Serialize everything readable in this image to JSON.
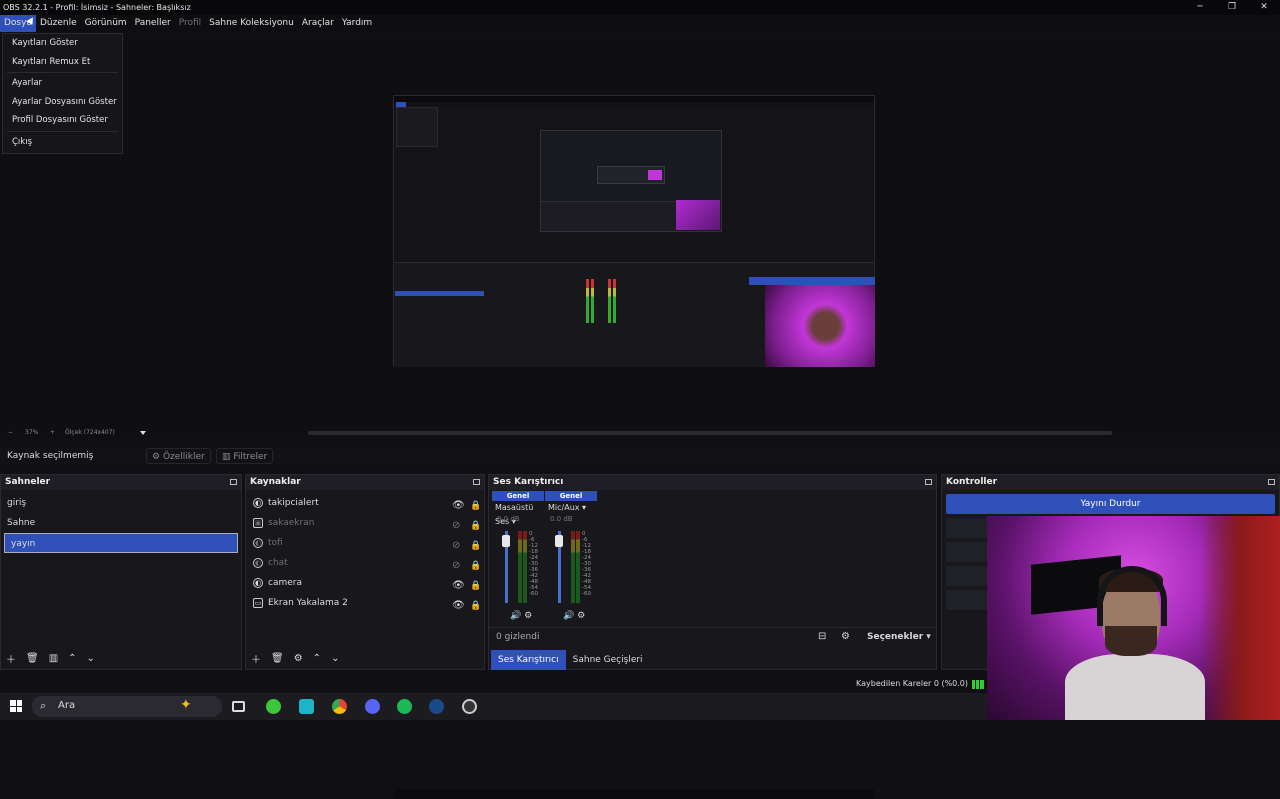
{
  "window": {
    "title": "OBS 32.2.1 - Profil: İsimsiz - Sahneler: Başlıksız",
    "minimize": "─",
    "restore": "❐",
    "close": "✕"
  },
  "menu": {
    "items": [
      "Dosya",
      "Düzenle",
      "Görünüm",
      "Paneller",
      "Profil",
      "Sahne Koleksiyonu",
      "Araçlar",
      "Yardım"
    ],
    "dosya_dropdown": [
      "Kayıtları Göster",
      "Kayıtları Remux Et",
      "Ayarlar",
      "Ayarlar Dosyasını Göster",
      "Profil Dosyasını Göster",
      "Çıkış"
    ]
  },
  "preview": {
    "zoom_minus": "−",
    "zoom_value": "37%",
    "zoom_plus": "+",
    "scale": "Ölçek (724x407)"
  },
  "source_bar": {
    "label": "Kaynak seçilmemiş",
    "properties": "Özellikler",
    "filters": "Filtreler"
  },
  "scenes": {
    "title": "Sahneler",
    "items": [
      "giriş",
      "Sahne",
      "yayın"
    ],
    "selected": "yayın"
  },
  "sources": {
    "title": "Kaynaklar",
    "items": [
      {
        "name": "takipcialert",
        "visible": true
      },
      {
        "name": "sakaekran",
        "visible": false
      },
      {
        "name": "tofi",
        "visible": false
      },
      {
        "name": "chat",
        "visible": false
      },
      {
        "name": "camera",
        "visible": true
      },
      {
        "name": "Ekran Yakalama 2",
        "visible": true
      }
    ]
  },
  "mixer": {
    "title": "Ses Karıştırıcı",
    "channels": [
      {
        "group": "Genel",
        "name": "Masaüstü Ses",
        "db": "0.0 dB"
      },
      {
        "group": "Genel",
        "name": "Mic/Aux",
        "db": "0.0 dB"
      }
    ],
    "ticks": [
      "0",
      "-6",
      "-12",
      "-18",
      "-24",
      "-30",
      "-36",
      "-42",
      "-48",
      "-54",
      "-60"
    ],
    "hidden": "0 gizlendi",
    "options": "Seçenekler",
    "tab_mixer": "Ses Karıştırıcı",
    "tab_transitions": "Sahne Geçişleri"
  },
  "controls": {
    "title": "Kontroller",
    "stop_stream": "Yayını Durdur"
  },
  "status": {
    "dropped": "Kaybedilen Kareler 0 (%0.0)"
  },
  "taskbar": {
    "search": "Ara"
  }
}
